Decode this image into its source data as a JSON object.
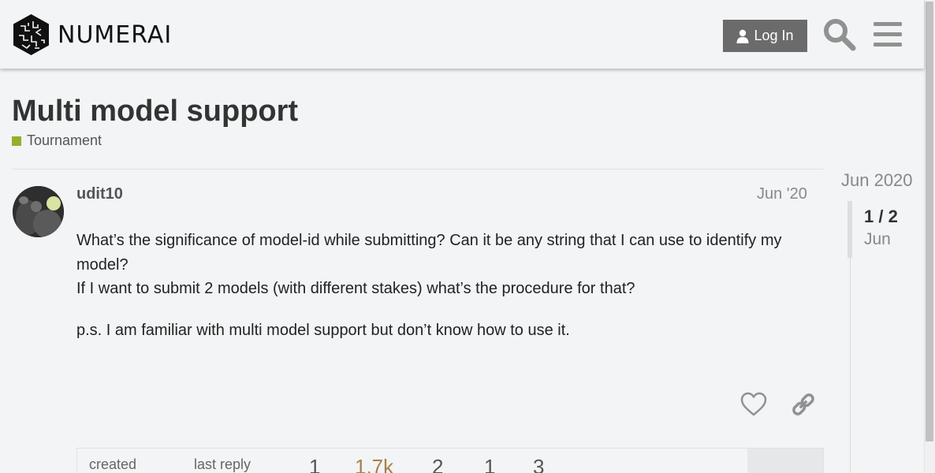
{
  "header": {
    "logo_text": "NUMERAI",
    "login_label": "Log In"
  },
  "topic": {
    "title": "Multi model support",
    "category": "Tournament",
    "category_color": "#92b029"
  },
  "post": {
    "username": "udit10",
    "date": "Jun '20",
    "paragraphs": [
      "What’s the significance of model-id while submitting? Can it be any string that I can use to identify my model?",
      "If I want to submit 2 models (with different stakes) what’s the procedure for that?",
      "p.s. I am familiar with multi model support but don’t know how to use it."
    ]
  },
  "meta": {
    "created_label": "created",
    "last_reply_label": "last reply",
    "replies": "1",
    "views": "1.7k",
    "users": "2",
    "likes": "1",
    "links": "3"
  },
  "timeline": {
    "date_top": "Jun 2020",
    "count": "1 / 2",
    "current_date": "Jun"
  }
}
